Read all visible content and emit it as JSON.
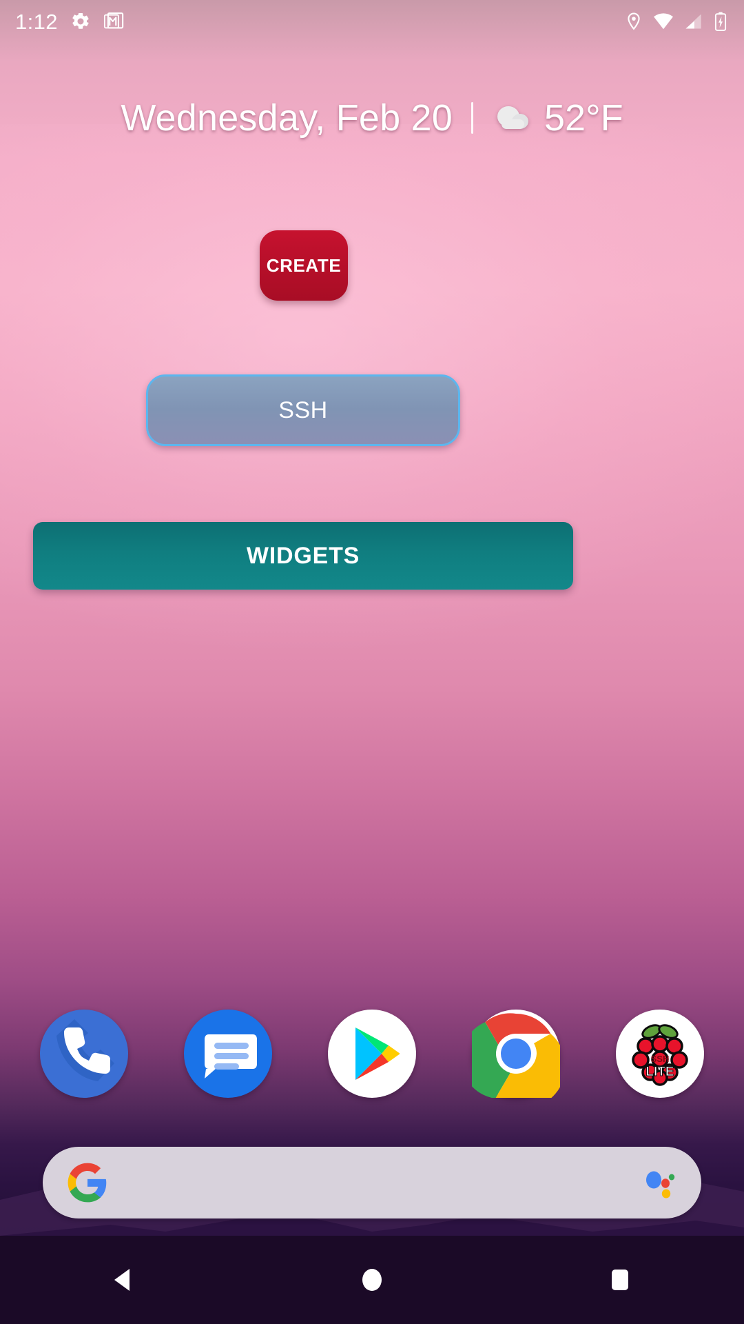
{
  "status_bar": {
    "clock": "1:12",
    "left_icons": [
      {
        "name": "settings-gear-icon",
        "label": "Settings"
      },
      {
        "name": "gmail-icon",
        "label": "Gmail"
      }
    ],
    "right_icons": [
      {
        "name": "location-pin-icon",
        "label": "Location"
      },
      {
        "name": "wifi-icon",
        "label": "Wi-Fi full"
      },
      {
        "name": "cellular-signal-icon",
        "label": "Cellular signal"
      },
      {
        "name": "battery-charging-icon",
        "label": "Battery charging"
      }
    ]
  },
  "date_widget": {
    "date": "Wednesday, Feb 20",
    "separator": "|",
    "weather_icon": "cloud-icon",
    "temperature": "52°F"
  },
  "home_widgets": [
    {
      "name": "create-widget",
      "label": "CREATE",
      "color": "#b50f29",
      "text_color": "#ffffff"
    },
    {
      "name": "ssh-widget",
      "label": "SSH",
      "color": "#8094b4",
      "border_color": "#5cb6ee",
      "text_color": "#ffffff"
    },
    {
      "name": "widgets-widget",
      "label": "WIDGETS",
      "color": "#107e80",
      "text_color": "#ffffff"
    }
  ],
  "dock": {
    "apps": [
      {
        "name": "phone-app-icon",
        "label": "Phone",
        "color": "#3b6fd4"
      },
      {
        "name": "messages-app-icon",
        "label": "Messages",
        "color": "#1a73e8"
      },
      {
        "name": "play-store-app-icon",
        "label": "Play Store",
        "color": "#ffffff"
      },
      {
        "name": "chrome-app-icon",
        "label": "Chrome",
        "color": "#ffffff"
      },
      {
        "name": "raspberry-ssh-lite-app-icon",
        "label": "SSH LITE",
        "color": "#ffffff",
        "badge_top": "SSH",
        "badge_bottom": "LITE"
      }
    ]
  },
  "search_bar": {
    "placeholder": "",
    "value": "",
    "google_logo": "google-g-icon",
    "assistant_icon": "google-assistant-icon",
    "background": "#d8d2dc"
  },
  "nav_bar": {
    "buttons": [
      {
        "name": "nav-back-button",
        "label": "Back"
      },
      {
        "name": "nav-home-button",
        "label": "Home"
      },
      {
        "name": "nav-recents-button",
        "label": "Recents"
      }
    ]
  }
}
